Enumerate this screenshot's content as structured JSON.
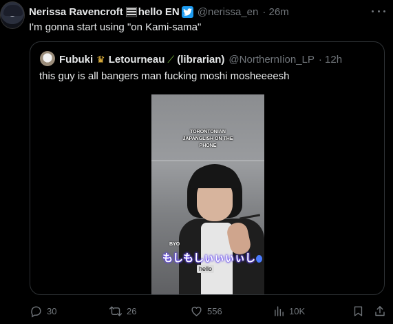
{
  "tweet": {
    "author_name": "Nerissa Ravencroft",
    "author_name_suffix": "hello EN",
    "handle": "@nerissa_en",
    "time": "· 26m",
    "text": "I'm gonna start using \"on Kami-sama\""
  },
  "quote": {
    "author_first": "Fubuki",
    "author_last": "Letourneau",
    "author_suffix": "(librarian)",
    "handle": "@NorthernIion_LP",
    "time": "· 12h",
    "text": "this guy is all bangers man fucking moshi mosheeeesh",
    "video": {
      "caption_top": "TORONTONIAN JAPANGLISH ON THE PHONE",
      "caption_small": "BYO",
      "caption_jp": "もしもしぃぃぃぃし",
      "caption_hello": "hello"
    }
  },
  "actions": {
    "replies": "30",
    "retweets": "26",
    "likes": "556",
    "views": "10K"
  },
  "colors": {
    "background": "#000000",
    "text": "#e7e9ea",
    "muted": "#71767b",
    "border": "#2f3336",
    "verified": "#1d9bf0"
  }
}
